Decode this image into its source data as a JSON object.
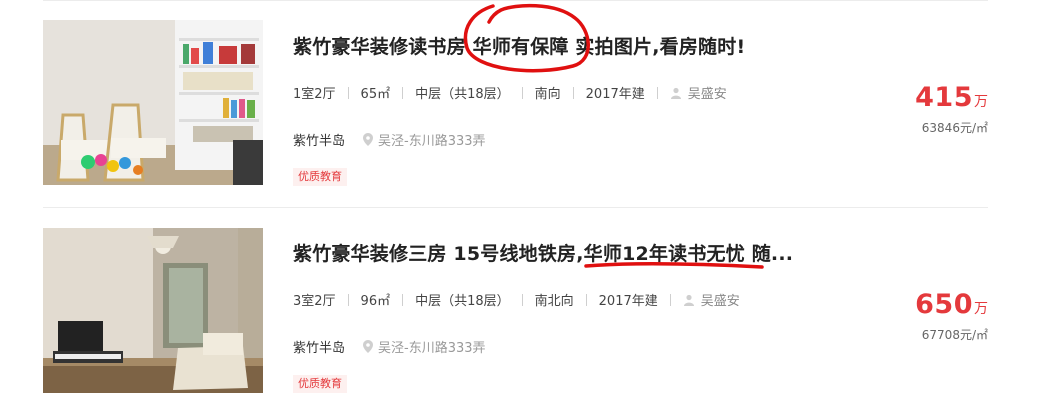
{
  "listings": [
    {
      "title": "紫竹豪华装修读书房 华师有保障 实拍图片,看房随时!",
      "layout": "1室2厅",
      "area": "65㎡",
      "floor": "中层（共18层）",
      "orientation": "南向",
      "year": "2017年建",
      "agent": "吴盛安",
      "community": "紫竹半岛",
      "address": "吴泾-东川路333弄",
      "tag": "优质教育",
      "price": "415",
      "price_unit": "万",
      "unit_price": "63846元/㎡"
    },
    {
      "title": "紫竹豪华装修三房 15号线地铁房,华师12年读书无忧 随...",
      "layout": "3室2厅",
      "area": "96㎡",
      "floor": "中层（共18层）",
      "orientation": "南北向",
      "year": "2017年建",
      "agent": "吴盛安",
      "community": "紫竹半岛",
      "address": "吴泾-东川路333弄",
      "tag": "优质教育",
      "price": "650",
      "price_unit": "万",
      "unit_price": "67708元/㎡"
    }
  ],
  "icons": {
    "agent": "person-icon",
    "address": "location-pin-icon"
  },
  "colors": {
    "price": "#e4393c",
    "annotation": "#e01010",
    "tag_bg": "#fdf0ef"
  }
}
